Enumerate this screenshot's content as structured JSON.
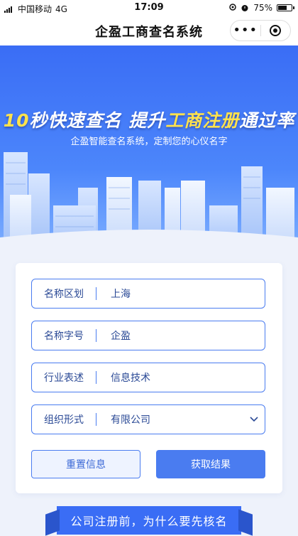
{
  "status_bar": {
    "carrier": "中国移动",
    "network": "4G",
    "time": "17:09",
    "battery": "75%",
    "battery_level": 0.75
  },
  "nav": {
    "title": "企盈工商查名系统",
    "more_icon": "more-dots-icon",
    "close_icon": "target-close-icon"
  },
  "banner": {
    "headline_num": "10",
    "headline_a": "秒快速查名  提升",
    "headline_b": "工商注册",
    "headline_c": "通过率",
    "subline": "企盈智能查名系统，定制您的心仪名字"
  },
  "form": {
    "fields": [
      {
        "label": "名称区划",
        "value": "上海"
      },
      {
        "label": "名称字号",
        "value": "企盈"
      },
      {
        "label": "行业表述",
        "value": "信息技术"
      },
      {
        "label": "组织形式",
        "value": "有限公司"
      }
    ],
    "reset_label": "重置信息",
    "submit_label": "获取结果"
  },
  "footer": {
    "ribbon_text": "公司注册前，为什么要先核名"
  },
  "colors": {
    "primary": "#4a7cf0",
    "banner_top": "#3a6df5",
    "accent_yellow": "#ffe24d"
  }
}
